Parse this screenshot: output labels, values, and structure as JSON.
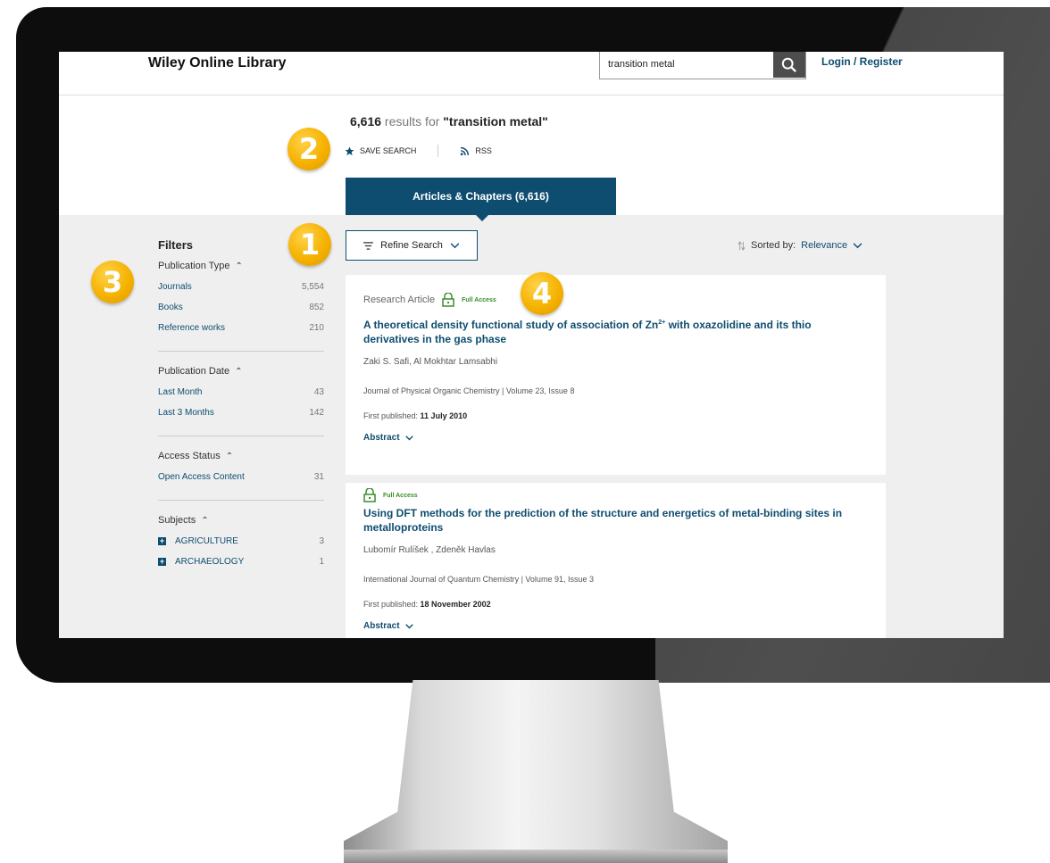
{
  "header": {
    "site_title": "Wiley Online Library",
    "search_value": "transition metal",
    "login_label": "Login / Register"
  },
  "results": {
    "count": "6,616",
    "results_for": " results for ",
    "query": "\"transition metal\"",
    "save_search_label": "SAVE SEARCH",
    "rss_label": "RSS",
    "tab_label": "Articles & Chapters (6,616)"
  },
  "toolbar": {
    "refine_label": "Refine Search",
    "sort_prefix": "Sorted by:",
    "sort_value": "Relevance"
  },
  "filters": {
    "title": "Filters",
    "publication_type": {
      "label": "Publication Type",
      "items": [
        {
          "label": "Journals",
          "count": "5,554"
        },
        {
          "label": "Books",
          "count": "852"
        },
        {
          "label": "Reference works",
          "count": "210"
        }
      ]
    },
    "publication_date": {
      "label": "Publication Date",
      "items": [
        {
          "label": "Last Month",
          "count": "43"
        },
        {
          "label": "Last 3 Months",
          "count": "142"
        }
      ]
    },
    "access_status": {
      "label": "Access Status",
      "items": [
        {
          "label": "Open Access Content",
          "count": "31"
        }
      ]
    },
    "subjects": {
      "label": "Subjects",
      "items": [
        {
          "label": "AGRICULTURE",
          "count": "3"
        },
        {
          "label": "ARCHAEOLOGY",
          "count": "1"
        }
      ]
    }
  },
  "articles": [
    {
      "type": "Research Article",
      "access": "Full Access",
      "title_pre": "A theoretical density functional study of association of Zn",
      "title_sup": "2+",
      "title_post": " with oxazolidine and its thio derivatives in the gas phase",
      "authors": "Zaki S. Safi, Al Mokhtar Lamsabhi",
      "journal": "Journal of Physical Organic Chemistry | Volume 23, Issue 8",
      "first_published_label": "First published:",
      "first_published": "11 July 2010",
      "abstract_label": "Abstract"
    },
    {
      "access": "Full Access",
      "title": "Using DFT methods for the prediction of the structure and energetics of metal-binding sites in metalloproteins",
      "authors": "Lubomír Rulíšek , Zdeněk Havlas",
      "journal": "International Journal of Quantum Chemistry | Volume 91, Issue 3",
      "first_published_label": "First published:",
      "first_published": "18 November 2002",
      "abstract_label": "Abstract"
    }
  ],
  "callouts": {
    "one": "1",
    "two": "2",
    "three": "3",
    "four": "4"
  },
  "icons": {
    "search": "search-icon",
    "star": "star-icon",
    "rss": "rss-icon",
    "filter": "filter-lines-icon",
    "sort": "sort-arrows-icon",
    "lock": "unlocked-icon",
    "chevron": "chevron-down-icon"
  },
  "colors": {
    "brand": "#0e4d70",
    "badge": "#f5b200",
    "full_access": "#3a8d2a",
    "content_bg": "#efefef"
  }
}
